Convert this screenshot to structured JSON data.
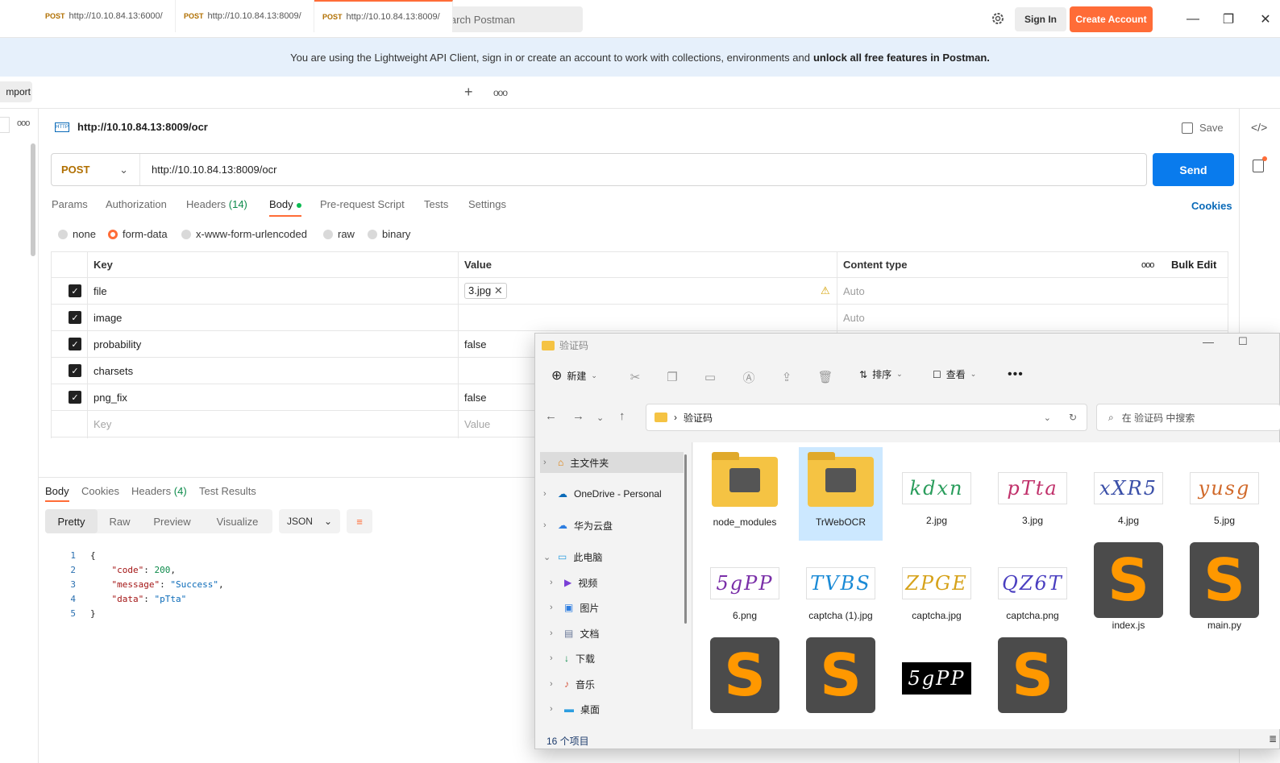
{
  "topbar": {
    "search_placeholder": "Search Postman",
    "signin": "Sign In",
    "create_account": "Create Account"
  },
  "banner": {
    "text": "You are using the Lightweight API Client, sign in or create an account to work with collections, environments and",
    "bold": "unlock all free features in Postman."
  },
  "import_label": "mport",
  "tabs": [
    {
      "method": "POST",
      "url": "http://10.10.84.13:6000/"
    },
    {
      "method": "POST",
      "url": "http://10.10.84.13:8009/"
    },
    {
      "method": "POST",
      "url": "http://10.10.84.13:8009/"
    }
  ],
  "request": {
    "title": "http://10.10.84.13:8009/ocr",
    "save": "Save",
    "method": "POST",
    "url": "http://10.10.84.13:8009/ocr",
    "send": "Send",
    "tabs": [
      "Params",
      "Authorization",
      "Headers",
      "Body",
      "Pre-request Script",
      "Tests",
      "Settings"
    ],
    "headers_count": "(14)",
    "cookies": "Cookies",
    "body_types": [
      "none",
      "form-data",
      "x-www-form-urlencoded",
      "raw",
      "binary"
    ],
    "columns": {
      "key": "Key",
      "value": "Value",
      "content_type": "Content type",
      "bulk_edit": "Bulk Edit"
    },
    "rows": [
      {
        "key": "file",
        "value": "3.jpg",
        "content_type": "Auto"
      },
      {
        "key": "image",
        "value": "",
        "content_type": "Auto"
      },
      {
        "key": "probability",
        "value": "false",
        "content_type": ""
      },
      {
        "key": "charsets",
        "value": "",
        "content_type": ""
      },
      {
        "key": "png_fix",
        "value": "false",
        "content_type": ""
      }
    ],
    "placeholder_key": "Key",
    "placeholder_value": "Value"
  },
  "response": {
    "tabs": [
      "Body",
      "Cookies",
      "Headers",
      "Test Results"
    ],
    "headers_count": "(4)",
    "views": [
      "Pretty",
      "Raw",
      "Preview",
      "Visualize"
    ],
    "format": "JSON",
    "lines": [
      "1",
      "2",
      "3",
      "4",
      "5"
    ],
    "code_key": "\"code\"",
    "code_val": "200",
    "message_key": "\"message\"",
    "message_val": "\"Success\"",
    "data_key": "\"data\"",
    "data_val": "\"pTta\""
  },
  "explorer": {
    "title": "验证码",
    "new": "新建",
    "sort": "排序",
    "view": "查看",
    "path": "验证码",
    "search_placeholder": "在 验证码 中搜索",
    "nav": [
      "主文件夹",
      "OneDrive - Personal",
      "华为云盘",
      "此电脑",
      "视频",
      "图片",
      "文档",
      "下载",
      "音乐",
      "桌面"
    ],
    "files": [
      "node_modules",
      "TrWebOCR",
      "2.jpg",
      "3.jpg",
      "4.jpg",
      "5.jpg",
      "6.png",
      "captcha (1).jpg",
      "captcha.jpg",
      "captcha.png",
      "index.js",
      "main.py"
    ],
    "captcha_texts": [
      "kdxn",
      "pTta",
      "xXR5",
      "yusg",
      "5gPP",
      "TVBS",
      "ZPGE",
      "QZ6T",
      "5gPP"
    ],
    "status": "16 个项目"
  },
  "colors": {
    "accent": "#ff6c37",
    "send": "#097bed",
    "method": "#b06f00"
  }
}
